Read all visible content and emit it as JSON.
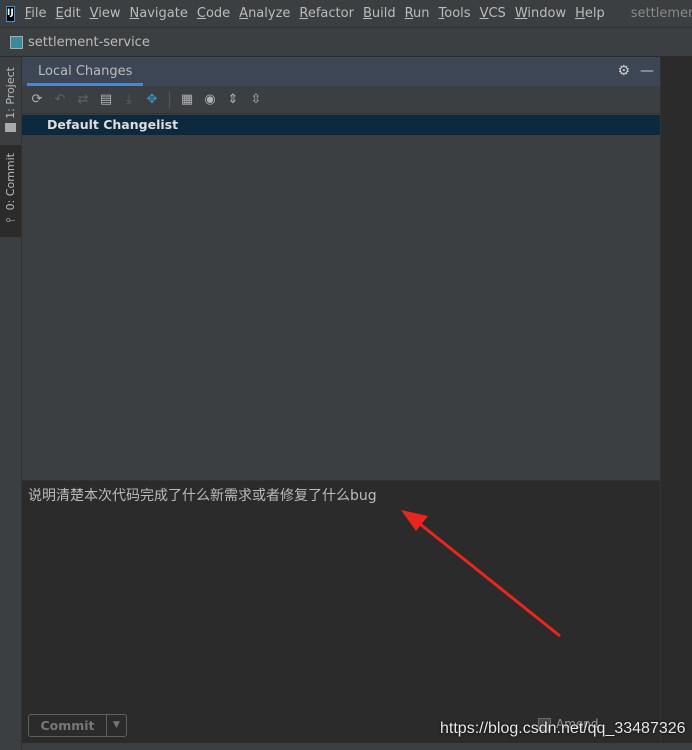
{
  "menubar": {
    "logo": "IJ",
    "items": [
      "File",
      "Edit",
      "View",
      "Navigate",
      "Code",
      "Analyze",
      "Refactor",
      "Build",
      "Run",
      "Tools",
      "VCS",
      "Window",
      "Help"
    ],
    "window_title": "settlement"
  },
  "navbar": {
    "project": "settlement-service"
  },
  "stripe": {
    "project": "1: Project",
    "commit": "0: Commit"
  },
  "panel": {
    "tab": "Local Changes",
    "changelist": "Default Changelist",
    "toolbar": [
      "refresh-icon",
      "rollback-icon",
      "diff-icon",
      "shelve-icon",
      "update-icon",
      "merge-icon",
      "group-by-icon",
      "view-options-icon",
      "expand-all-icon",
      "collapse-all-icon"
    ]
  },
  "commit": {
    "message": "说明清楚本次代码完成了什么新需求或者修复了什么bug",
    "button": "Commit",
    "amend": "Amend"
  },
  "annotation": {
    "arrow_color": "#e8261d"
  },
  "watermark": "https://blog.csdn.net/qq_33487326"
}
